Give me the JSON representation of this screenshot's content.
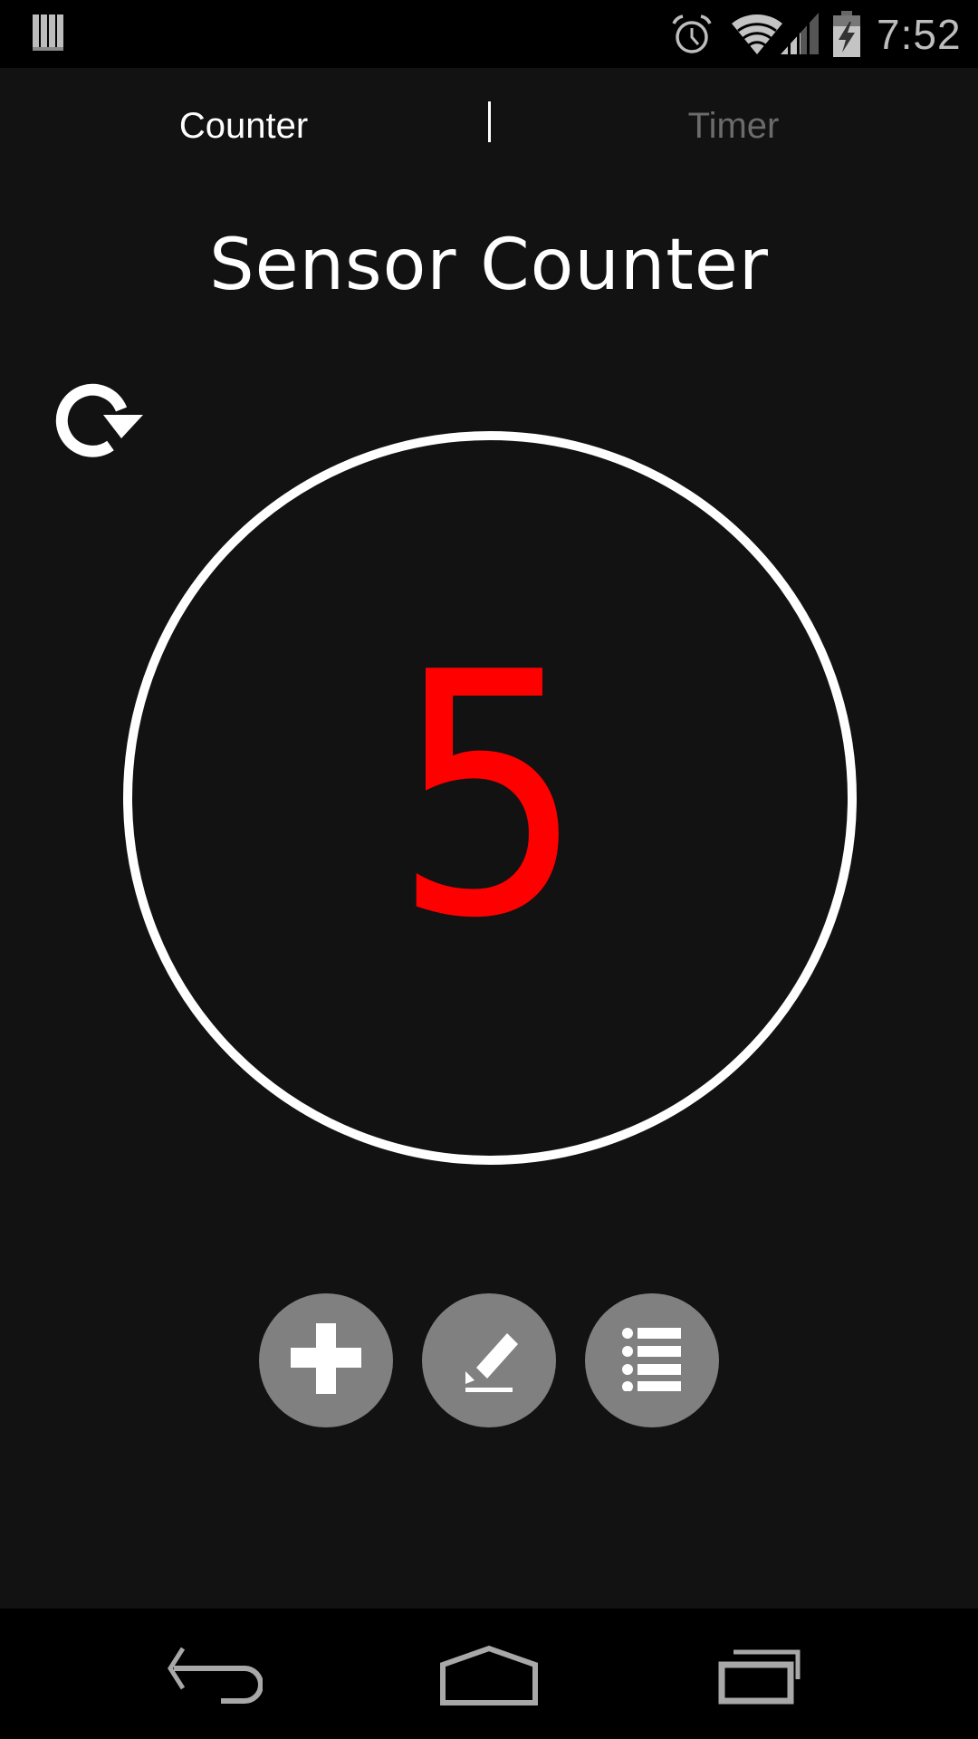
{
  "status_bar": {
    "time": "7:52",
    "icons": [
      "notification-bars-icon",
      "alarm-icon",
      "wifi-icon",
      "cell-signal-icon",
      "battery-charging-icon"
    ]
  },
  "tabs": [
    {
      "label": "Counter",
      "active": true
    },
    {
      "label": "Timer",
      "active": false
    }
  ],
  "main": {
    "title": "Sensor Counter",
    "count": "5",
    "count_color": "#ff0000",
    "reset_icon": "refresh-icon"
  },
  "actions": [
    {
      "name": "add",
      "icon": "plus-icon"
    },
    {
      "name": "edit",
      "icon": "pencil-icon"
    },
    {
      "name": "list",
      "icon": "list-icon"
    }
  ],
  "nav_bar": {
    "buttons": [
      "back",
      "home",
      "recents"
    ]
  },
  "colors": {
    "background": "#121212",
    "accent": "#ff0000",
    "fab": "#808080",
    "inactive_tab": "#6b6b6b"
  }
}
